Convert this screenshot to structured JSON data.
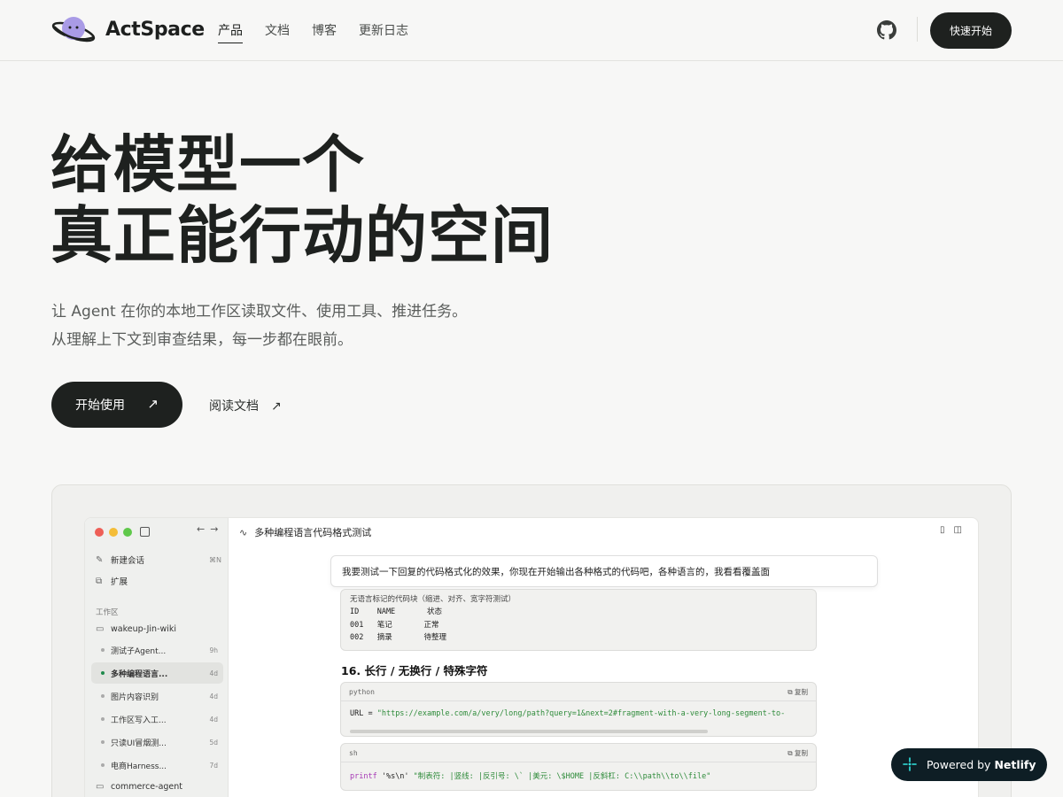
{
  "header": {
    "brand": "ActSpace",
    "nav": [
      {
        "label": "产品",
        "active": true
      },
      {
        "label": "文档"
      },
      {
        "label": "博客"
      },
      {
        "label": "更新日志"
      }
    ],
    "quick_start": "快速开始"
  },
  "hero": {
    "title_line1": "给模型一个",
    "title_line2": "真正能行动的空间",
    "sub_line1": "让 Agent 在你的本地工作区读取文件、使用工具、推进任务。",
    "sub_line2": "从理解上下文到审查结果，每一步都在眼前。",
    "primary_cta": "开始使用",
    "secondary_cta": "阅读文档",
    "arrow": "↗"
  },
  "preview": {
    "sidebar": {
      "new_chat": "新建会话",
      "new_chat_kbd": "⌘N",
      "extensions": "扩展",
      "section": "工作区",
      "workspace1": "wakeup-Jin-wiki",
      "items": [
        {
          "label": "测试子Agent...",
          "time": "9h"
        },
        {
          "label": "多种编程语言...",
          "time": "4d",
          "active": true
        },
        {
          "label": "图片内容识别",
          "time": "4d"
        },
        {
          "label": "工作区写入工...",
          "time": "4d"
        },
        {
          "label": "只读UI冒烟测...",
          "time": "5d"
        },
        {
          "label": "电商Harness...",
          "time": "7d"
        }
      ],
      "workspace2": "commerce-agent"
    },
    "conversation_title": "多种编程语言代码格式测试",
    "prompt": "我要测试一下回复的代码格式化的效果，你现在开始输出各种格式的代码吧，各种语言的，我看看覆盖面",
    "plain_block": {
      "caption": "无语言标记的代码块（缩进、对齐、宽字符测试）",
      "lines": [
        "ID    NAME       状态",
        "001   笔记       正常",
        "002   摘录       待整理"
      ]
    },
    "heading": "16. 长行 / 无换行 / 特殊字符",
    "copy_label": "复制",
    "python_block": {
      "lang": "python",
      "code_prefix": "URL = ",
      "code_string": "\"https://example.com/a/very/long/path?query=1&next=2#fragment-with-a-very-long-segment-to-"
    },
    "sh_block": {
      "lang": "sh",
      "code_kw": "printf",
      "code_fmt": " '%s\\n' ",
      "code_string": "\"制表符:   |竖线: |反引号: \\` |美元: \\$HOME |反斜杠: C:\\\\path\\\\to\\\\file\""
    }
  },
  "badge": {
    "prefix": "Powered by",
    "brand": "Netlify"
  },
  "colors": {
    "background": "#f7f7f6",
    "primary": "#1e211f",
    "accent_logo": "#a99be6",
    "netlify_bg": "#0e1e25",
    "netlify_accent": "#32e6e2"
  }
}
